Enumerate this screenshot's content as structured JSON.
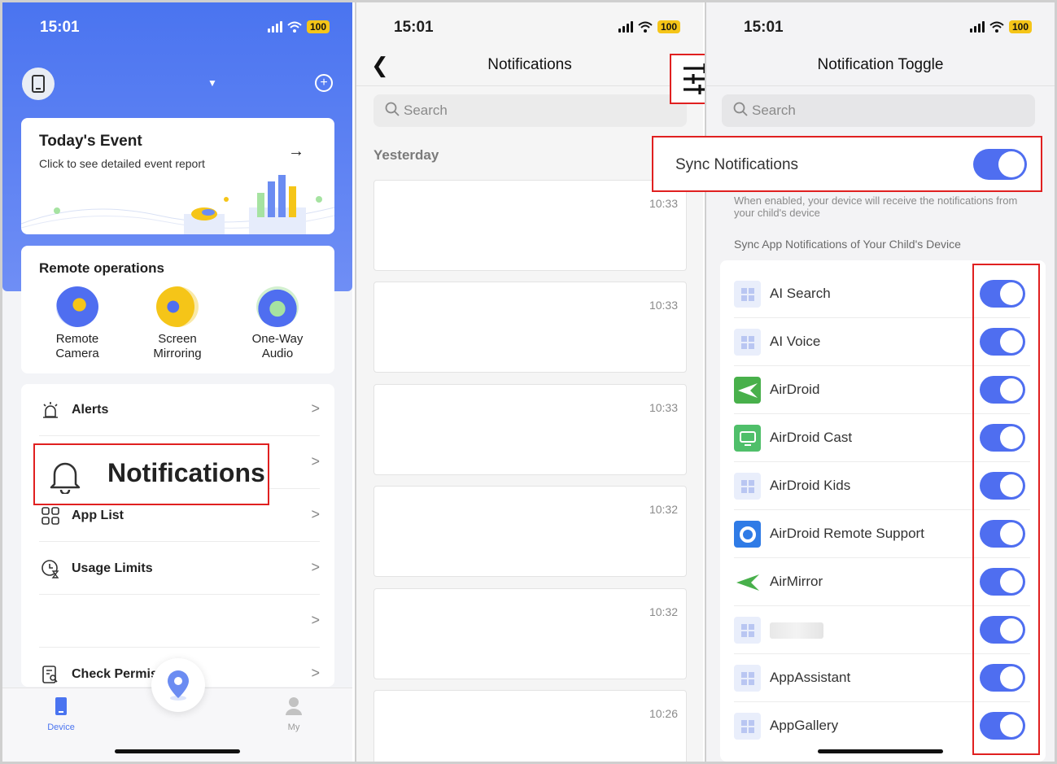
{
  "status_bar": {
    "time": "15:01",
    "battery": "100"
  },
  "panel1": {
    "event_card": {
      "title": "Today's Event",
      "subtitle": "Click to see detailed event report"
    },
    "remote_ops": {
      "title": "Remote operations",
      "items": [
        {
          "label": "Remote\nCamera",
          "icon": "camera-icon"
        },
        {
          "label": "Screen\nMirroring",
          "icon": "binoculars-icon"
        },
        {
          "label": "One-Way\nAudio",
          "icon": "headphones-icon"
        }
      ]
    },
    "menu": {
      "alerts": "Alerts",
      "notifications": "Notifications",
      "app_list": "App List",
      "usage_limits": "Usage Limits",
      "check_permissions": "Check Permis"
    },
    "tabs": {
      "device": "Device",
      "my": "My"
    },
    "accent_color": "#4a74f0"
  },
  "panel2": {
    "title": "Notifications",
    "search_placeholder": "Search",
    "section": "Yesterday",
    "items": [
      {
        "time": "10:33"
      },
      {
        "time": "10:33"
      },
      {
        "time": "10:33"
      },
      {
        "time": "10:32"
      },
      {
        "time": "10:32"
      },
      {
        "time": "10:26"
      }
    ]
  },
  "panel3": {
    "title": "Notification Toggle",
    "search_placeholder": "Search",
    "sync_label": "Sync Notifications",
    "sync_enabled": true,
    "sync_description": "When enabled, your device will receive the notifications from your child's device",
    "sync_subheading": "Sync App Notifications of Your Child's Device",
    "apps": [
      {
        "name": "AI Search",
        "enabled": true
      },
      {
        "name": "AI Voice",
        "enabled": true
      },
      {
        "name": "AirDroid",
        "enabled": true
      },
      {
        "name": "AirDroid Cast",
        "enabled": true
      },
      {
        "name": "AirDroid Kids",
        "enabled": true
      },
      {
        "name": "AirDroid Remote Support",
        "enabled": true
      },
      {
        "name": "AirMirror",
        "enabled": true
      },
      {
        "name": "",
        "enabled": true
      },
      {
        "name": "AppAssistant",
        "enabled": true
      },
      {
        "name": "AppGallery",
        "enabled": true
      }
    ],
    "toggle_color": "#4f6ef0",
    "highlight_color": "#e02020"
  }
}
